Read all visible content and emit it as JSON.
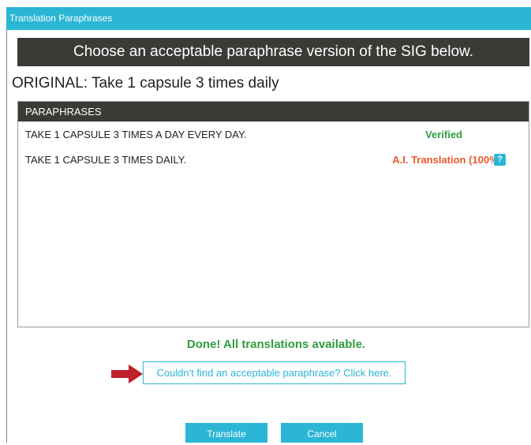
{
  "window": {
    "title": "Translation Paraphrases"
  },
  "banner": {
    "text": "Choose an acceptable paraphrase version of the SIG below."
  },
  "original": {
    "text": "ORIGINAL: Take 1 capsule 3 times daily"
  },
  "paraphrases": {
    "header": "PARAPHRASES",
    "items": [
      {
        "text": "TAKE 1 CAPSULE 3 TIMES A DAY EVERY DAY.",
        "status": "Verified"
      },
      {
        "text": "TAKE 1 CAPSULE 3 TIMES DAILY.",
        "status": "A.I. Translation (100%)",
        "help": "?"
      }
    ]
  },
  "status_message": "Done! All translations available.",
  "help_link": "Couldn't find an acceptable paraphrase? Click here.",
  "buttons": {
    "translate": "Translate",
    "cancel": "Cancel"
  },
  "colors": {
    "accent": "#2bb6d6",
    "verified": "#2e9e3e",
    "ai": "#e8582b",
    "header_bg": "#3b3a37",
    "arrow": "#c0202a"
  }
}
